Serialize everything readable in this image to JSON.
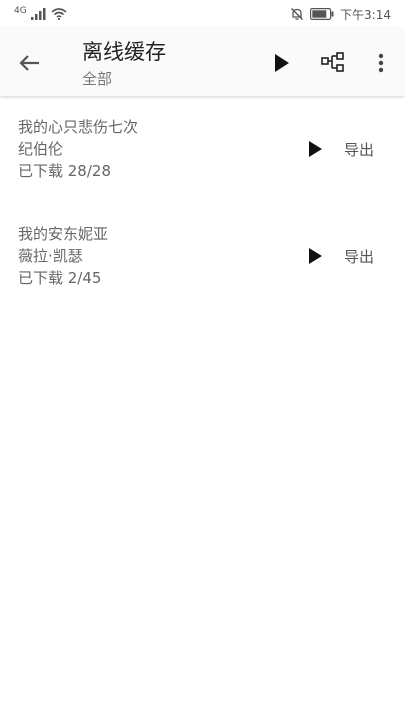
{
  "status": {
    "network_label": "4G",
    "time": "下午3:14"
  },
  "header": {
    "title": "离线缓存",
    "subtitle": "全部",
    "icons": [
      "back-arrow-icon",
      "play-icon",
      "tree-icon",
      "more-vert-icon"
    ]
  },
  "items": [
    {
      "title": "我的心只悲伤七次",
      "artist": "纪伯伦",
      "progress": "已下载 28/28",
      "export_label": "导出"
    },
    {
      "title": "我的安东妮亚",
      "artist": "薇拉·凯瑟",
      "progress": "已下载 2/45",
      "export_label": "导出"
    }
  ]
}
